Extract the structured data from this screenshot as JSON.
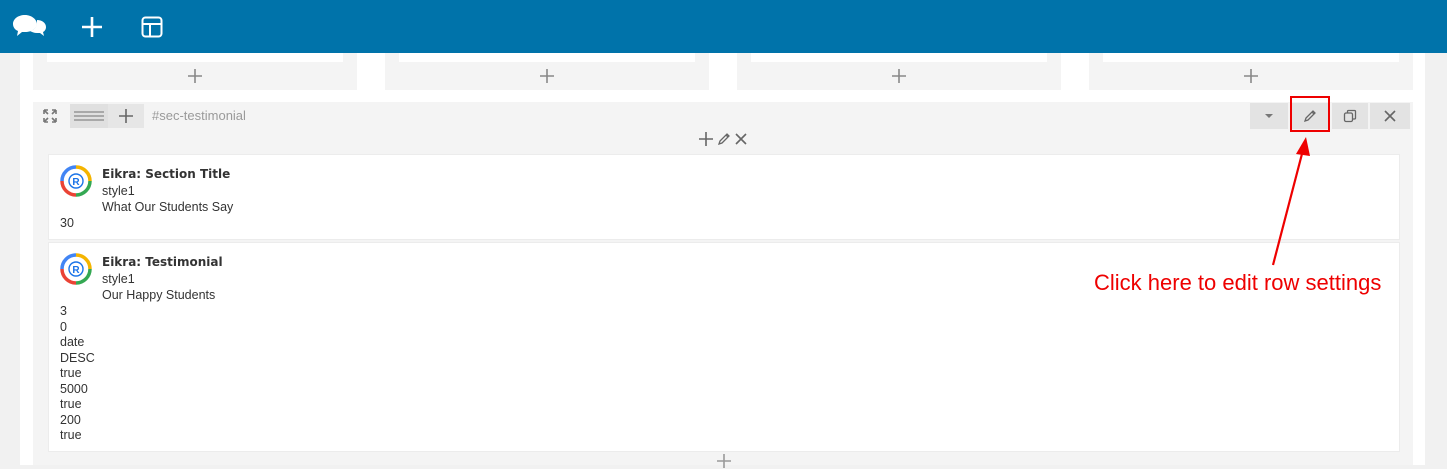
{
  "topbar": {
    "icons": [
      "chat-bubbles-icon",
      "plus-icon",
      "layout-icon"
    ]
  },
  "row": {
    "id_label": "#sec-testimonial"
  },
  "widgets": [
    {
      "title": "Eikra: Section Title",
      "lines": [
        "style1",
        "What Our Students Say"
      ],
      "values": [
        "30"
      ]
    },
    {
      "title": "Eikra: Testimonial",
      "lines": [
        "style1",
        "Our Happy Students"
      ],
      "values": [
        "3",
        "0",
        "date",
        "DESC",
        "true",
        "5000",
        "true",
        "200",
        "true"
      ]
    }
  ],
  "annotation": {
    "text": "Click here to edit row settings"
  },
  "colors": {
    "topbar": "#0073aa",
    "annotation": "#e00000"
  }
}
